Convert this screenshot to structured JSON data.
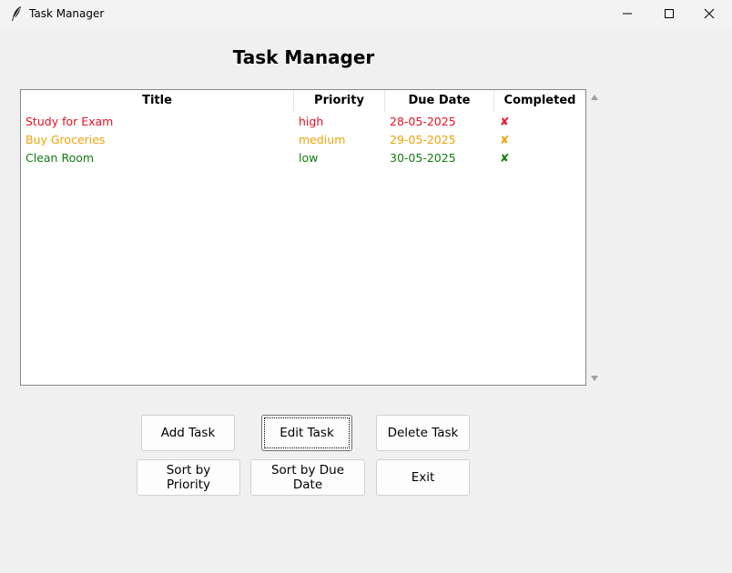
{
  "window": {
    "title": "Task Manager",
    "app_icon": "feather-icon",
    "controls": [
      "minimize-icon",
      "maximize-icon",
      "close-icon"
    ]
  },
  "heading": "Task Manager",
  "table": {
    "columns": [
      "Title",
      "Priority",
      "Due Date",
      "Completed"
    ],
    "rows": [
      {
        "title": "Study for Exam",
        "priority": "high",
        "due": "28-05-2025",
        "completed": "✘",
        "color": "#e81123"
      },
      {
        "title": "Buy Groceries",
        "priority": "medium",
        "due": "29-05-2025",
        "completed": "✘",
        "color": "#f0a30a"
      },
      {
        "title": "Clean Room",
        "priority": "low",
        "due": "30-05-2025",
        "completed": "✘",
        "color": "#107c10"
      }
    ]
  },
  "buttons": {
    "add": "Add Task",
    "edit": "Edit Task",
    "delete": "Delete Task",
    "sort_priority": "Sort by Priority",
    "sort_due": "Sort by Due Date",
    "exit": "Exit"
  }
}
